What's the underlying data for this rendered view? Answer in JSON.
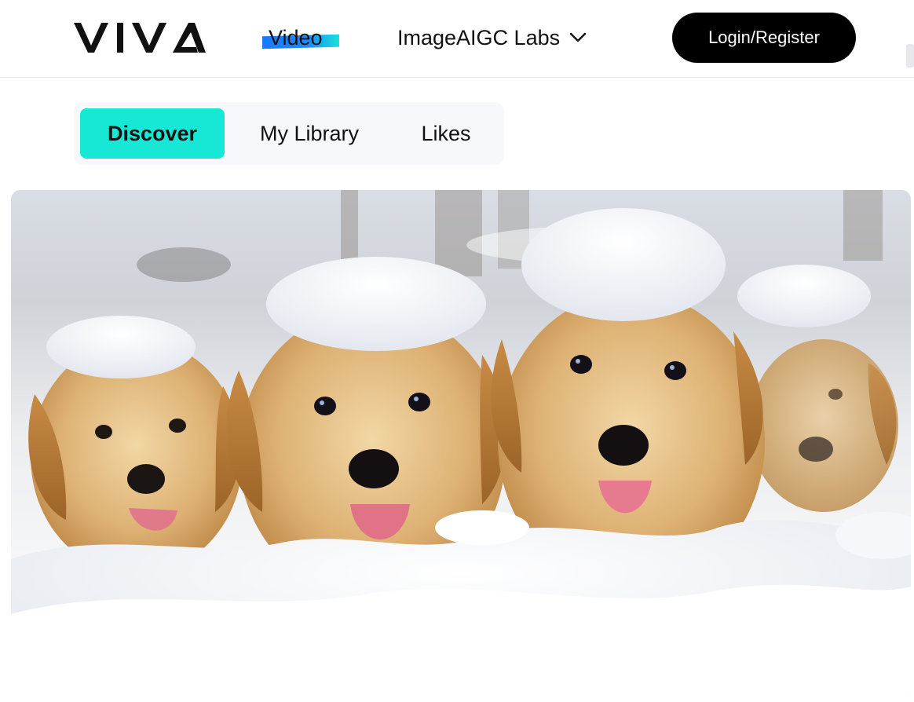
{
  "header": {
    "logo_text": "VIVA",
    "nav": {
      "video_label": "Video",
      "labs_label": "ImageAIGC Labs"
    },
    "login_label": "Login/Register"
  },
  "tabs": [
    {
      "label": "Discover",
      "active": true
    },
    {
      "label": "My Library",
      "active": false
    },
    {
      "label": "Likes",
      "active": false
    }
  ],
  "hero": {
    "subject": "golden retriever puppies in snow"
  },
  "colors": {
    "accent_teal": "#17e8d6",
    "video_highlight": "#1b78ff",
    "login_bg": "#000000"
  },
  "icons": [
    "chevron-down-icon"
  ]
}
